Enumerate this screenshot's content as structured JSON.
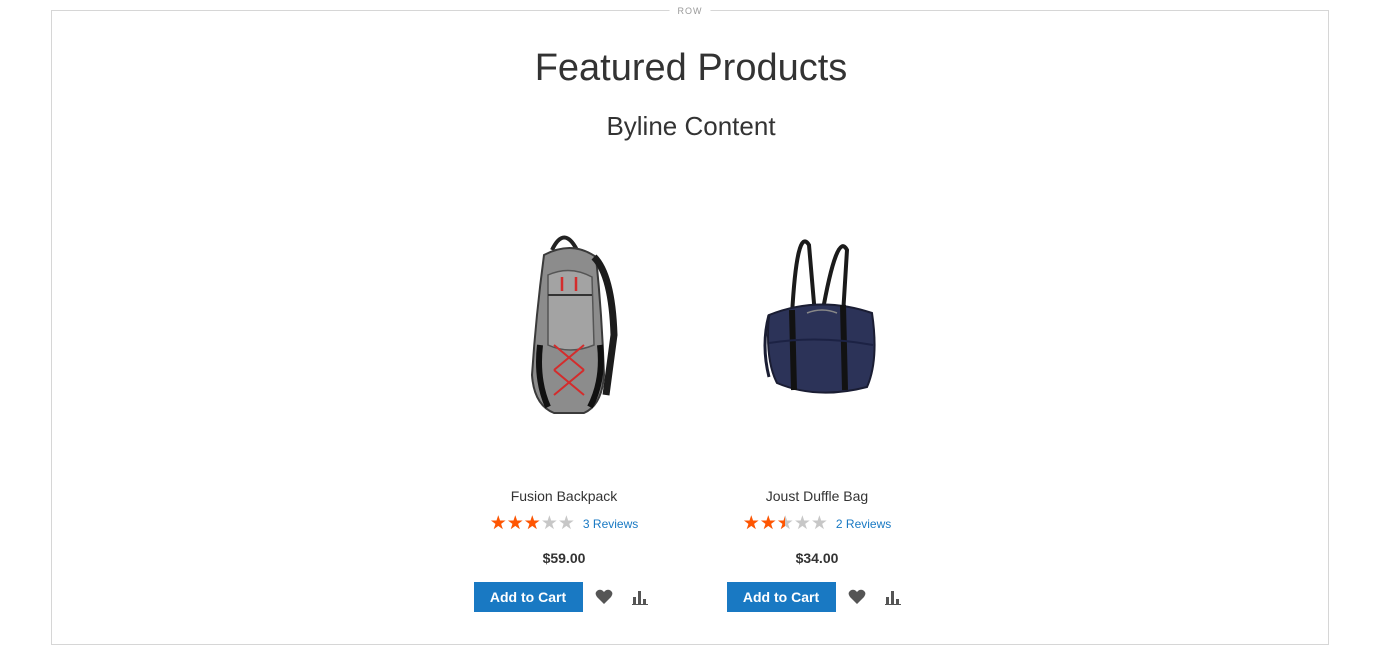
{
  "row": {
    "label": "ROW"
  },
  "header": {
    "title": "Featured Products",
    "byline": "Byline Content"
  },
  "products": [
    {
      "name": "Fusion Backpack",
      "image": "backpack-image",
      "rating_stars": 5,
      "rating_fraction": 0.6,
      "reviews": "3 Reviews",
      "price": "$59.00",
      "add_to_cart": "Add to Cart",
      "wishlist_icon": "heart-icon",
      "compare_icon": "bar-chart-icon"
    },
    {
      "name": "Joust Duffle Bag",
      "image": "duffle-bag-image",
      "rating_stars": 5,
      "rating_fraction": 0.5,
      "reviews": "2 Reviews",
      "price": "$34.00",
      "add_to_cart": "Add to Cart",
      "wishlist_icon": "heart-icon",
      "compare_icon": "bar-chart-icon"
    }
  ],
  "colors": {
    "accent": "#1979c3",
    "star_filled": "#ff5501",
    "star_empty": "#c7c7c7",
    "text": "#333333",
    "frame_border": "#d6d6d6"
  }
}
